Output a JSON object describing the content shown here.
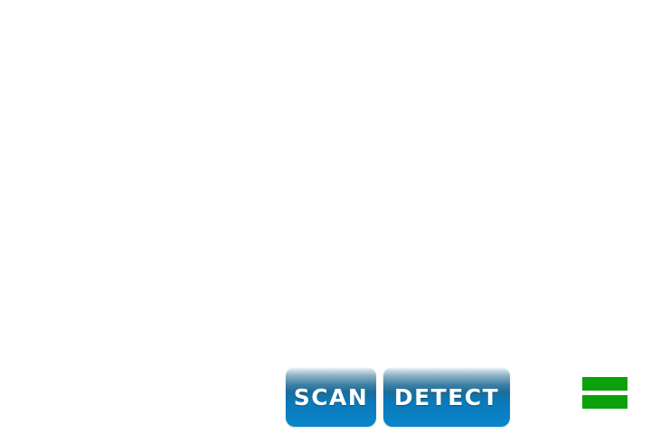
{
  "controls": {
    "scan_label": "SCAN",
    "detect_label": "DETECT"
  },
  "menu": {
    "icon": "menu-icon",
    "color": "#0aa10a"
  },
  "colors": {
    "button_top": "#ffffff",
    "button_mid": "#1a6d9a",
    "button_bottom": "#0a86cb",
    "background": "#ffffff"
  }
}
